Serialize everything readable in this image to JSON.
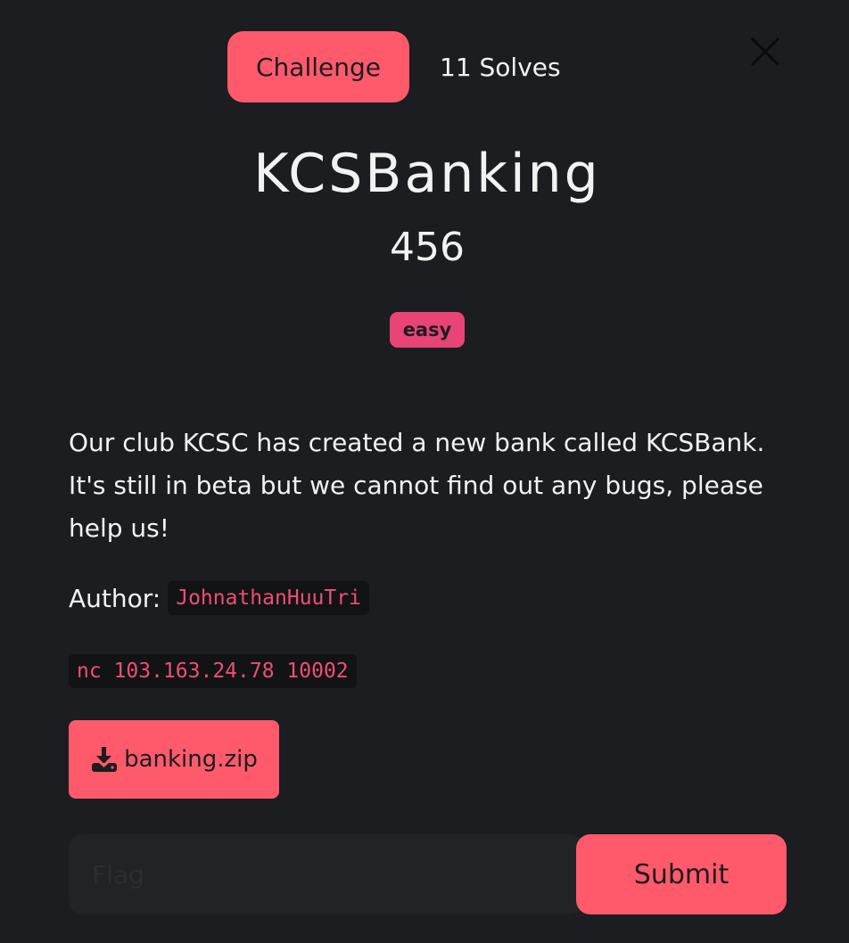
{
  "tabs": {
    "challenge_label": "Challenge",
    "solves_label": "11 Solves"
  },
  "challenge": {
    "name": "KCSBanking",
    "points": "456",
    "difficulty": "easy",
    "description": "Our club KCSC has created a new bank called KCSBank. It's still in beta but we cannot find out any bugs, please help us!",
    "author_label": "Author:",
    "author": "JohnathanHuuTri",
    "connection": "nc 103.163.24.78 10002",
    "file_name": "banking.zip"
  },
  "form": {
    "flag_placeholder": "Flag",
    "submit_label": "Submit"
  },
  "icons": {
    "close": "close-icon",
    "download": "download-icon"
  },
  "colors": {
    "background": "#1c1d20",
    "accent": "#fe5a6b",
    "badge": "#e84478",
    "code_text": "#ee4e77",
    "code_bg": "#121315",
    "input_bg": "#222326"
  }
}
